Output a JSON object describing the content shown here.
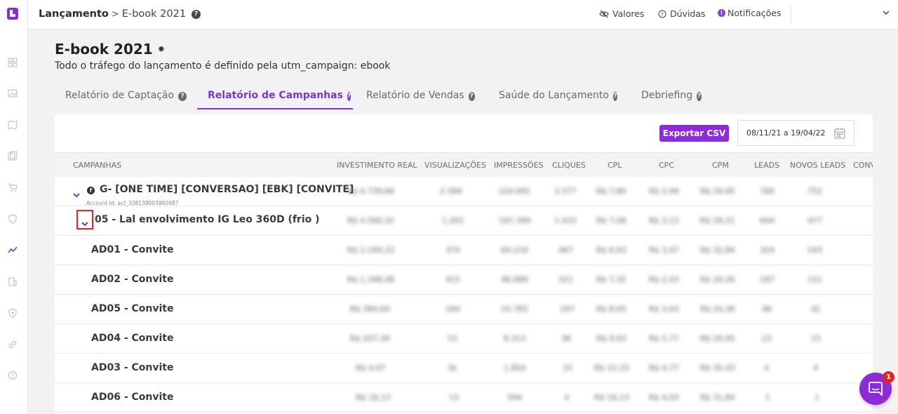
{
  "topbar": {
    "breadcrumb_root": "Lançamento",
    "breadcrumb_sep": ">",
    "breadcrumb_current": "E-book 2021",
    "help_glyph": "?",
    "links": {
      "valores": "Valores",
      "duvidas": "Dúvidas",
      "notificacoes": "Notificações"
    },
    "notif_glyph": "!"
  },
  "header": {
    "title": "E-book 2021",
    "subtitle": "Todo o tráfego do lançamento é definido pela utm_campaign: ebook"
  },
  "tabs": [
    {
      "label": "Relatório de Captação",
      "active": false
    },
    {
      "label": "Relatório de Campanhas",
      "active": true
    },
    {
      "label": "Relatório de Vendas",
      "active": false
    },
    {
      "label": "Saúde do Lançamento",
      "active": false
    },
    {
      "label": "Debriefing",
      "active": false
    }
  ],
  "toolbar": {
    "export_label": "Exportar CSV",
    "date_range": "08/11/21 a 19/04/22"
  },
  "table": {
    "columns": [
      "Campanhas",
      "Investimento Real",
      "Visualizações",
      "Impressões",
      "Cliques",
      "CPL",
      "CPC",
      "CPM",
      "Leads",
      "Novos Leads",
      "Conv"
    ],
    "campaign": {
      "name": "G- [ONE TIME] [CONVERSAO] [EBK] [CONVITE]",
      "account_id": "Account Id: act_338138003992687",
      "values": [
        "R$ 4.739,66",
        "2.394",
        "224.691",
        "3.377",
        "R$ 7,80",
        "R$ 2,94",
        "R$ 29,95",
        "760",
        "752"
      ]
    },
    "adset": {
      "name": "05 - Lal envolvimento IG Leo 360D (frio )",
      "values": [
        "R$ 4.560,32",
        "1.201",
        "197.394",
        "1.433",
        "R$ 7,08",
        "R$ 3,13",
        "R$ 28,21",
        "644",
        "477"
      ]
    },
    "ads": [
      {
        "name": "AD01 - Convite",
        "values": [
          "R$ 2.194,22",
          "374",
          "64.219",
          "467",
          "R$ 6,93",
          "R$ 3,47",
          "R$ 32,84",
          "324",
          "243"
        ]
      },
      {
        "name": "AD02 - Convite",
        "values": [
          "R$ 1.348,48",
          "415",
          "46.089",
          "321",
          "R$ 7,32",
          "R$ 2,43",
          "R$ 29,26",
          "187",
          "151"
        ]
      },
      {
        "name": "AD05 - Convite",
        "values": [
          "R$ 384,64",
          "164",
          "15.783",
          "107",
          "R$ 8,05",
          "R$ 3,03",
          "R$ 24,36",
          "46",
          "41"
        ]
      },
      {
        "name": "AD04 - Convite",
        "values": [
          "R$ 207,39",
          "53",
          "8.313",
          "36",
          "R$ 9,03",
          "R$ 5,77",
          "R$ 24,95",
          "23",
          "15"
        ]
      },
      {
        "name": "AD03 - Convite",
        "values": [
          "R$ 4,97",
          "3k",
          "1.854",
          "15",
          "R$ 15,33",
          "R$ 4,77",
          "R$ 35,43",
          "4",
          "4"
        ]
      },
      {
        "name": "AD06 - Convite",
        "values": [
          "R$ 16,13",
          "13",
          "504",
          "4",
          "R$ 16,13",
          "R$ 4,03",
          "R$ 31,84",
          "1",
          "1"
        ]
      }
    ]
  },
  "chat": {
    "badge": "1"
  },
  "colors": {
    "accent": "#8d2bd6",
    "highlight": "#e0242b"
  },
  "icons": {
    "sidebar": [
      "dashboard-icon",
      "image-icon",
      "map-icon",
      "copy-icon",
      "cart-icon",
      "shield-icon",
      "trend-icon",
      "building-icon",
      "security-icon",
      "link-icon",
      "info-icon"
    ]
  }
}
